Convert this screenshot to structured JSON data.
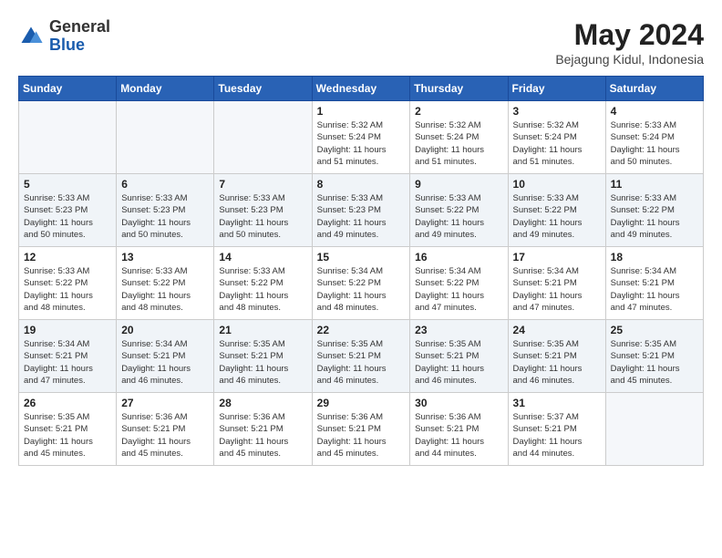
{
  "header": {
    "logo_general": "General",
    "logo_blue": "Blue",
    "month_year": "May 2024",
    "location": "Bejagung Kidul, Indonesia"
  },
  "weekdays": [
    "Sunday",
    "Monday",
    "Tuesday",
    "Wednesday",
    "Thursday",
    "Friday",
    "Saturday"
  ],
  "weeks": [
    [
      {
        "day": "",
        "info": ""
      },
      {
        "day": "",
        "info": ""
      },
      {
        "day": "",
        "info": ""
      },
      {
        "day": "1",
        "info": "Sunrise: 5:32 AM\nSunset: 5:24 PM\nDaylight: 11 hours\nand 51 minutes."
      },
      {
        "day": "2",
        "info": "Sunrise: 5:32 AM\nSunset: 5:24 PM\nDaylight: 11 hours\nand 51 minutes."
      },
      {
        "day": "3",
        "info": "Sunrise: 5:32 AM\nSunset: 5:24 PM\nDaylight: 11 hours\nand 51 minutes."
      },
      {
        "day": "4",
        "info": "Sunrise: 5:33 AM\nSunset: 5:24 PM\nDaylight: 11 hours\nand 50 minutes."
      }
    ],
    [
      {
        "day": "5",
        "info": "Sunrise: 5:33 AM\nSunset: 5:23 PM\nDaylight: 11 hours\nand 50 minutes."
      },
      {
        "day": "6",
        "info": "Sunrise: 5:33 AM\nSunset: 5:23 PM\nDaylight: 11 hours\nand 50 minutes."
      },
      {
        "day": "7",
        "info": "Sunrise: 5:33 AM\nSunset: 5:23 PM\nDaylight: 11 hours\nand 50 minutes."
      },
      {
        "day": "8",
        "info": "Sunrise: 5:33 AM\nSunset: 5:23 PM\nDaylight: 11 hours\nand 49 minutes."
      },
      {
        "day": "9",
        "info": "Sunrise: 5:33 AM\nSunset: 5:22 PM\nDaylight: 11 hours\nand 49 minutes."
      },
      {
        "day": "10",
        "info": "Sunrise: 5:33 AM\nSunset: 5:22 PM\nDaylight: 11 hours\nand 49 minutes."
      },
      {
        "day": "11",
        "info": "Sunrise: 5:33 AM\nSunset: 5:22 PM\nDaylight: 11 hours\nand 49 minutes."
      }
    ],
    [
      {
        "day": "12",
        "info": "Sunrise: 5:33 AM\nSunset: 5:22 PM\nDaylight: 11 hours\nand 48 minutes."
      },
      {
        "day": "13",
        "info": "Sunrise: 5:33 AM\nSunset: 5:22 PM\nDaylight: 11 hours\nand 48 minutes."
      },
      {
        "day": "14",
        "info": "Sunrise: 5:33 AM\nSunset: 5:22 PM\nDaylight: 11 hours\nand 48 minutes."
      },
      {
        "day": "15",
        "info": "Sunrise: 5:34 AM\nSunset: 5:22 PM\nDaylight: 11 hours\nand 48 minutes."
      },
      {
        "day": "16",
        "info": "Sunrise: 5:34 AM\nSunset: 5:22 PM\nDaylight: 11 hours\nand 47 minutes."
      },
      {
        "day": "17",
        "info": "Sunrise: 5:34 AM\nSunset: 5:21 PM\nDaylight: 11 hours\nand 47 minutes."
      },
      {
        "day": "18",
        "info": "Sunrise: 5:34 AM\nSunset: 5:21 PM\nDaylight: 11 hours\nand 47 minutes."
      }
    ],
    [
      {
        "day": "19",
        "info": "Sunrise: 5:34 AM\nSunset: 5:21 PM\nDaylight: 11 hours\nand 47 minutes."
      },
      {
        "day": "20",
        "info": "Sunrise: 5:34 AM\nSunset: 5:21 PM\nDaylight: 11 hours\nand 46 minutes."
      },
      {
        "day": "21",
        "info": "Sunrise: 5:35 AM\nSunset: 5:21 PM\nDaylight: 11 hours\nand 46 minutes."
      },
      {
        "day": "22",
        "info": "Sunrise: 5:35 AM\nSunset: 5:21 PM\nDaylight: 11 hours\nand 46 minutes."
      },
      {
        "day": "23",
        "info": "Sunrise: 5:35 AM\nSunset: 5:21 PM\nDaylight: 11 hours\nand 46 minutes."
      },
      {
        "day": "24",
        "info": "Sunrise: 5:35 AM\nSunset: 5:21 PM\nDaylight: 11 hours\nand 46 minutes."
      },
      {
        "day": "25",
        "info": "Sunrise: 5:35 AM\nSunset: 5:21 PM\nDaylight: 11 hours\nand 45 minutes."
      }
    ],
    [
      {
        "day": "26",
        "info": "Sunrise: 5:35 AM\nSunset: 5:21 PM\nDaylight: 11 hours\nand 45 minutes."
      },
      {
        "day": "27",
        "info": "Sunrise: 5:36 AM\nSunset: 5:21 PM\nDaylight: 11 hours\nand 45 minutes."
      },
      {
        "day": "28",
        "info": "Sunrise: 5:36 AM\nSunset: 5:21 PM\nDaylight: 11 hours\nand 45 minutes."
      },
      {
        "day": "29",
        "info": "Sunrise: 5:36 AM\nSunset: 5:21 PM\nDaylight: 11 hours\nand 45 minutes."
      },
      {
        "day": "30",
        "info": "Sunrise: 5:36 AM\nSunset: 5:21 PM\nDaylight: 11 hours\nand 44 minutes."
      },
      {
        "day": "31",
        "info": "Sunrise: 5:37 AM\nSunset: 5:21 PM\nDaylight: 11 hours\nand 44 minutes."
      },
      {
        "day": "",
        "info": ""
      }
    ]
  ]
}
